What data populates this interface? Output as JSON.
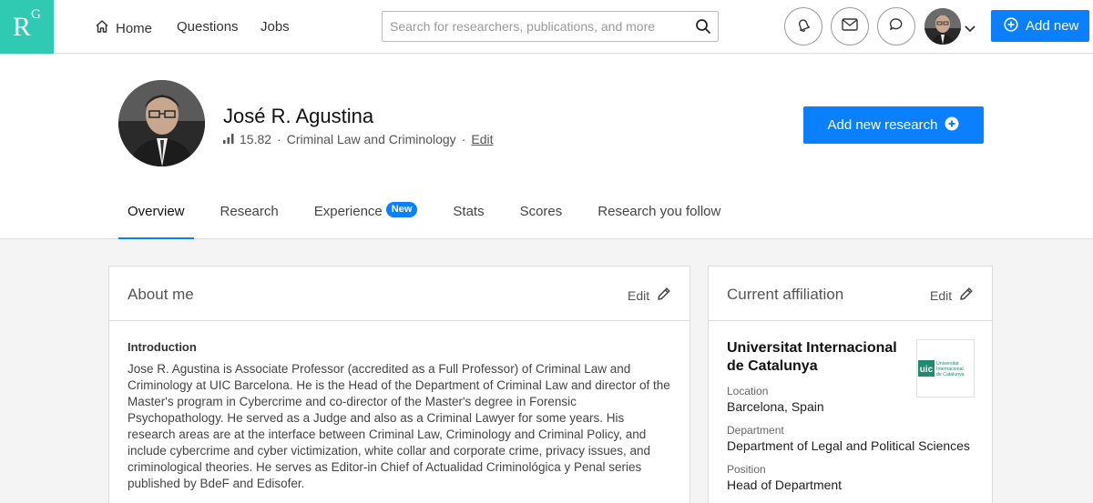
{
  "nav": {
    "logo_r": "R",
    "logo_g": "G",
    "home_label": "Home",
    "questions_label": "Questions",
    "jobs_label": "Jobs",
    "search_placeholder": "Search for researchers, publications, and more",
    "add_new_label": "Add new",
    "brand_color": "#2fcab1",
    "accent_color": "#0a80ff"
  },
  "profile": {
    "name": "José R. Agustina",
    "score": "15.82",
    "separator": "·",
    "field": "Criminal Law and Criminology",
    "edit_label": "Edit",
    "add_research_label": "Add new research"
  },
  "tabs": [
    {
      "label": "Overview",
      "active": true
    },
    {
      "label": "Research"
    },
    {
      "label": "Experience",
      "badge": "New"
    },
    {
      "label": "Stats"
    },
    {
      "label": "Scores"
    },
    {
      "label": "Research you follow"
    }
  ],
  "about": {
    "title": "About me",
    "edit_label": "Edit",
    "intro_title": "Introduction",
    "intro_text": "Jose R. Agustina is Associate Professor (accredited as a Full Professor) of Criminal Law and Criminology at UIC Barcelona. He is the Head of the Department of Criminal Law and director of the Master's program in Cybercrime and co-director of the Master's degree in Forensic Psychopathology. He served as a Judge and also as a Criminal Lawyer for some years. His research areas are at the interface between Criminal Law, Criminology and Criminal Policy, and include cybercrime and cyber victimization, white collar and corporate crime, privacy issues, and criminological theories. He serves as Editor-in Chief of Actualidad Criminológica y Penal series published by BdeF and Edisofer."
  },
  "affiliation": {
    "title": "Current affiliation",
    "edit_label": "Edit",
    "institution": "Universitat Internacional de Catalunya",
    "logo_mark": "uic",
    "logo_line1": "Universitat",
    "logo_line2": "Internacional",
    "logo_line3": "de Catalunya",
    "location_label": "Location",
    "location": "Barcelona, Spain",
    "department_label": "Department",
    "department": "Department of Legal and Political Sciences",
    "position_label": "Position",
    "position": "Head of Department"
  }
}
